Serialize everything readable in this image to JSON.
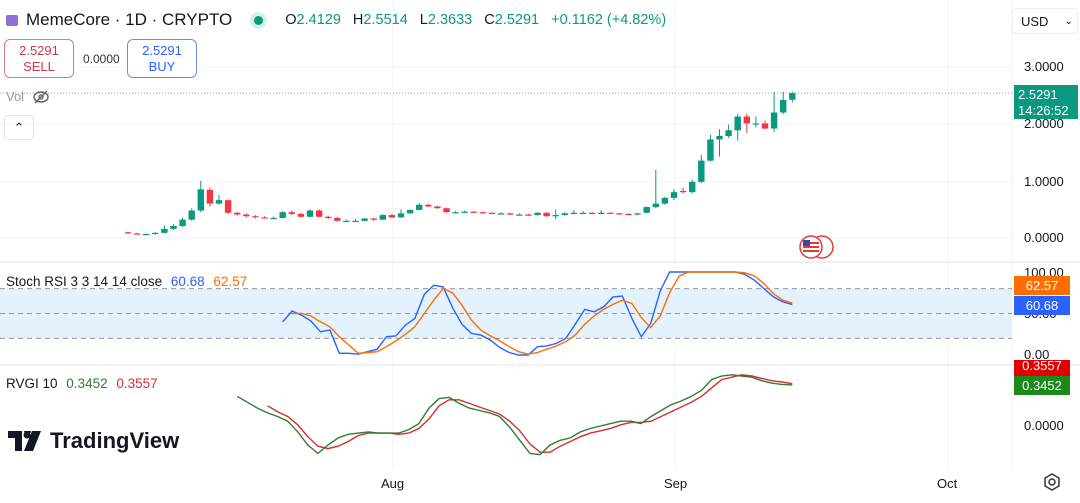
{
  "header": {
    "symbol": "MemeCore · 1D · CRYPTO",
    "o_label": "O",
    "o": "2.4129",
    "h_label": "H",
    "h": "2.5514",
    "l_label": "L",
    "l": "2.3633",
    "c_label": "C",
    "c": "2.5291",
    "change": "+0.1162 (+4.82%)"
  },
  "trade": {
    "sell_price": "2.5291",
    "sell_label": "SELL",
    "spread": "0.0000",
    "buy_price": "2.5291",
    "buy_label": "BUY"
  },
  "volume": {
    "label": "Vol",
    "icon": "eye-off-icon"
  },
  "currency": {
    "label": "USD",
    "icon": "chevron-down-icon"
  },
  "price_axis": {
    "ticks": [
      "3.0000",
      "2.0000",
      "1.0000",
      "0.0000"
    ],
    "last_price": "2.5291",
    "countdown": "14:26:52"
  },
  "stoch_rsi": {
    "title": "Stoch RSI 3 3 14 14 close",
    "k_value": "60.68",
    "d_value": "62.57",
    "ticks": [
      "100.00",
      "50.00",
      "0.00"
    ]
  },
  "rvgi": {
    "title": "RVGI 10",
    "value": "0.3452",
    "signal": "0.3557",
    "ticks": [
      "0.0000"
    ]
  },
  "time_axis": {
    "ticks": [
      "Aug",
      "Sep",
      "Oct"
    ]
  },
  "branding": {
    "logo": "TradingView"
  },
  "colors": {
    "up": "#089981",
    "down": "#f23645",
    "stoch_k": "#2962ff",
    "stoch_d": "#ff6d00",
    "rvgi": "#2e7d32",
    "rvgi_signal": "#d32f2f",
    "band": "#e3f2fd"
  },
  "chart_data": {
    "type": "candlestick",
    "ylim": [
      0,
      3
    ],
    "candles": [
      [
        "Jul 3",
        0.1,
        0.11,
        0.07,
        0.08
      ],
      [
        "Jul 4",
        0.08,
        0.09,
        0.06,
        0.07
      ],
      [
        "Jul 5",
        0.07,
        0.08,
        0.06,
        0.07
      ],
      [
        "Jul 6",
        0.07,
        0.1,
        0.06,
        0.09
      ],
      [
        "Jul 7",
        0.09,
        0.22,
        0.08,
        0.16
      ],
      [
        "Jul 8",
        0.16,
        0.24,
        0.14,
        0.21
      ],
      [
        "Jul 9",
        0.21,
        0.35,
        0.19,
        0.32
      ],
      [
        "Jul 10",
        0.32,
        0.52,
        0.3,
        0.48
      ],
      [
        "Jul 11",
        0.48,
        1.0,
        0.45,
        0.85
      ],
      [
        "Jul 12",
        0.84,
        0.88,
        0.55,
        0.6
      ],
      [
        "Jul 13",
        0.6,
        0.75,
        0.58,
        0.66
      ],
      [
        "Jul 14",
        0.66,
        0.67,
        0.42,
        0.44
      ],
      [
        "Jul 15",
        0.44,
        0.46,
        0.39,
        0.41
      ],
      [
        "Jul 16",
        0.41,
        0.43,
        0.36,
        0.38
      ],
      [
        "Jul 17",
        0.38,
        0.4,
        0.34,
        0.36
      ],
      [
        "Jul 18",
        0.36,
        0.38,
        0.34,
        0.35
      ],
      [
        "Jul 19",
        0.35,
        0.37,
        0.33,
        0.35
      ],
      [
        "Jul 20",
        0.35,
        0.47,
        0.34,
        0.45
      ],
      [
        "Jul 21",
        0.45,
        0.48,
        0.4,
        0.42
      ],
      [
        "Jul 22",
        0.42,
        0.44,
        0.36,
        0.37
      ],
      [
        "Jul 23",
        0.37,
        0.5,
        0.36,
        0.48
      ],
      [
        "Jul 24",
        0.48,
        0.5,
        0.36,
        0.37
      ],
      [
        "Jul 25",
        0.37,
        0.39,
        0.33,
        0.35
      ],
      [
        "Jul 26",
        0.35,
        0.37,
        0.29,
        0.3
      ],
      [
        "Jul 27",
        0.3,
        0.32,
        0.28,
        0.3
      ],
      [
        "Jul 28",
        0.3,
        0.33,
        0.28,
        0.3
      ],
      [
        "Jul 29",
        0.3,
        0.35,
        0.29,
        0.34
      ],
      [
        "Jul 30",
        0.34,
        0.35,
        0.3,
        0.32
      ],
      [
        "Jul 31",
        0.32,
        0.42,
        0.31,
        0.4
      ],
      [
        "Aug 1",
        0.4,
        0.42,
        0.35,
        0.36
      ],
      [
        "Aug 2",
        0.36,
        0.5,
        0.35,
        0.43
      ],
      [
        "Aug 3",
        0.43,
        0.5,
        0.42,
        0.49
      ],
      [
        "Aug 4",
        0.49,
        0.61,
        0.48,
        0.58
      ],
      [
        "Aug 5",
        0.58,
        0.6,
        0.54,
        0.55
      ],
      [
        "Aug 6",
        0.55,
        0.56,
        0.51,
        0.52
      ],
      [
        "Aug 7",
        0.52,
        0.53,
        0.44,
        0.45
      ],
      [
        "Aug 8",
        0.45,
        0.47,
        0.43,
        0.45
      ],
      [
        "Aug 9",
        0.45,
        0.48,
        0.44,
        0.46
      ],
      [
        "Aug 10",
        0.46,
        0.47,
        0.44,
        0.45
      ],
      [
        "Aug 11",
        0.45,
        0.46,
        0.43,
        0.44
      ],
      [
        "Aug 12",
        0.44,
        0.45,
        0.42,
        0.43
      ],
      [
        "Aug 13",
        0.43,
        0.45,
        0.42,
        0.43
      ],
      [
        "Aug 14",
        0.43,
        0.44,
        0.4,
        0.41
      ],
      [
        "Aug 15",
        0.41,
        0.43,
        0.39,
        0.41
      ],
      [
        "Aug 16",
        0.41,
        0.42,
        0.39,
        0.4
      ],
      [
        "Aug 17",
        0.4,
        0.45,
        0.39,
        0.44
      ],
      [
        "Aug 18",
        0.44,
        0.45,
        0.37,
        0.38
      ],
      [
        "Aug 19",
        0.38,
        0.5,
        0.33,
        0.4
      ],
      [
        "Aug 20",
        0.4,
        0.45,
        0.39,
        0.43
      ],
      [
        "Aug 21",
        0.43,
        0.49,
        0.42,
        0.44
      ],
      [
        "Aug 22",
        0.44,
        0.47,
        0.42,
        0.44
      ],
      [
        "Aug 23",
        0.44,
        0.45,
        0.41,
        0.43
      ],
      [
        "Aug 24",
        0.43,
        0.49,
        0.42,
        0.44
      ],
      [
        "Aug 25",
        0.44,
        0.45,
        0.42,
        0.43
      ],
      [
        "Aug 26",
        0.43,
        0.44,
        0.41,
        0.42
      ],
      [
        "Aug 27",
        0.42,
        0.43,
        0.4,
        0.41
      ],
      [
        "Aug 28",
        0.41,
        0.44,
        0.4,
        0.43
      ],
      [
        "Aug 29",
        0.44,
        0.55,
        0.43,
        0.54
      ],
      [
        "Aug 30",
        0.54,
        1.19,
        0.52,
        0.6
      ],
      [
        "Aug 31",
        0.6,
        0.72,
        0.58,
        0.7
      ],
      [
        "Sep 1",
        0.7,
        0.85,
        0.66,
        0.8
      ],
      [
        "Sep 2",
        0.82,
        0.88,
        0.78,
        0.8
      ],
      [
        "Sep 3",
        0.8,
        1.02,
        0.78,
        0.98
      ],
      [
        "Sep 4",
        0.98,
        1.45,
        0.96,
        1.35
      ],
      [
        "Sep 5",
        1.35,
        1.8,
        1.33,
        1.72
      ],
      [
        "Sep 6",
        1.72,
        1.9,
        1.42,
        1.78
      ],
      [
        "Sep 7",
        1.78,
        1.98,
        1.75,
        1.88
      ],
      [
        "Sep 8",
        1.88,
        2.17,
        1.7,
        2.12
      ],
      [
        "Sep 9",
        2.12,
        2.17,
        1.83,
        2.0
      ],
      [
        "Sep 10",
        2.0,
        2.12,
        1.93,
        2.0
      ],
      [
        "Sep 11",
        2.0,
        2.05,
        1.9,
        1.91
      ],
      [
        "Sep 12",
        1.91,
        2.55,
        1.85,
        2.19
      ],
      [
        "Sep 13",
        2.19,
        2.55,
        2.16,
        2.41
      ],
      [
        "Sep 14",
        2.4129,
        2.5514,
        2.3633,
        2.5291
      ]
    ],
    "stoch_k": [
      40,
      53,
      48,
      41,
      28,
      30,
      2,
      2,
      1,
      4,
      7,
      22,
      23,
      36,
      44,
      73,
      84,
      82,
      57,
      37,
      26,
      24,
      18,
      9,
      3,
      0,
      0,
      10,
      11,
      14,
      20,
      37,
      55,
      52,
      58,
      70,
      71,
      44,
      22,
      38,
      77,
      100,
      100,
      100,
      100,
      100,
      100,
      100,
      100,
      97,
      90,
      80,
      70,
      64,
      60.68
    ],
    "stoch_d": [
      null,
      50,
      50,
      47,
      40,
      34,
      22,
      12,
      2,
      3,
      4,
      10,
      17,
      25,
      34,
      50,
      66,
      80,
      75,
      60,
      42,
      30,
      23,
      17,
      10,
      4,
      1,
      3,
      7,
      11,
      16,
      24,
      37,
      47,
      55,
      61,
      66,
      62,
      45,
      33,
      47,
      75,
      95,
      100,
      100,
      100,
      100,
      100,
      100,
      99,
      95,
      86,
      74,
      66,
      62.57
    ],
    "stoch_bands": [
      80,
      50,
      20
    ],
    "rvgi": [
      0.25,
      0.2,
      0.15,
      0.11,
      0.08,
      0.04,
      -0.05,
      -0.16,
      -0.23,
      -0.16,
      -0.1,
      -0.07,
      -0.06,
      -0.05,
      -0.06,
      -0.06,
      -0.06,
      -0.03,
      0.02,
      0.15,
      0.23,
      0.24,
      0.19,
      0.15,
      0.13,
      0.11,
      0.08,
      -0.01,
      -0.12,
      -0.23,
      -0.24,
      -0.16,
      -0.12,
      -0.1,
      -0.05,
      -0.02,
      0.0,
      0.02,
      0.04,
      0.04,
      0.02,
      0.08,
      0.13,
      0.18,
      0.21,
      0.25,
      0.3,
      0.39,
      0.42,
      0.43,
      0.42,
      0.41,
      0.38,
      0.36,
      0.35,
      0.3452
    ],
    "rvgi_signal": [
      null,
      null,
      null,
      0.17,
      0.12,
      0.08,
      0.01,
      -0.09,
      -0.17,
      -0.19,
      -0.17,
      -0.13,
      -0.08,
      -0.06,
      -0.06,
      -0.06,
      -0.07,
      -0.06,
      -0.02,
      0.06,
      0.17,
      0.22,
      0.22,
      0.19,
      0.16,
      0.13,
      0.1,
      0.04,
      -0.04,
      -0.15,
      -0.22,
      -0.22,
      -0.17,
      -0.13,
      -0.09,
      -0.06,
      -0.04,
      -0.02,
      0.01,
      0.03,
      0.03,
      0.04,
      0.08,
      0.12,
      0.16,
      0.2,
      0.25,
      0.32,
      0.39,
      0.41,
      0.43,
      0.42,
      0.4,
      0.38,
      0.37,
      0.3557
    ]
  }
}
